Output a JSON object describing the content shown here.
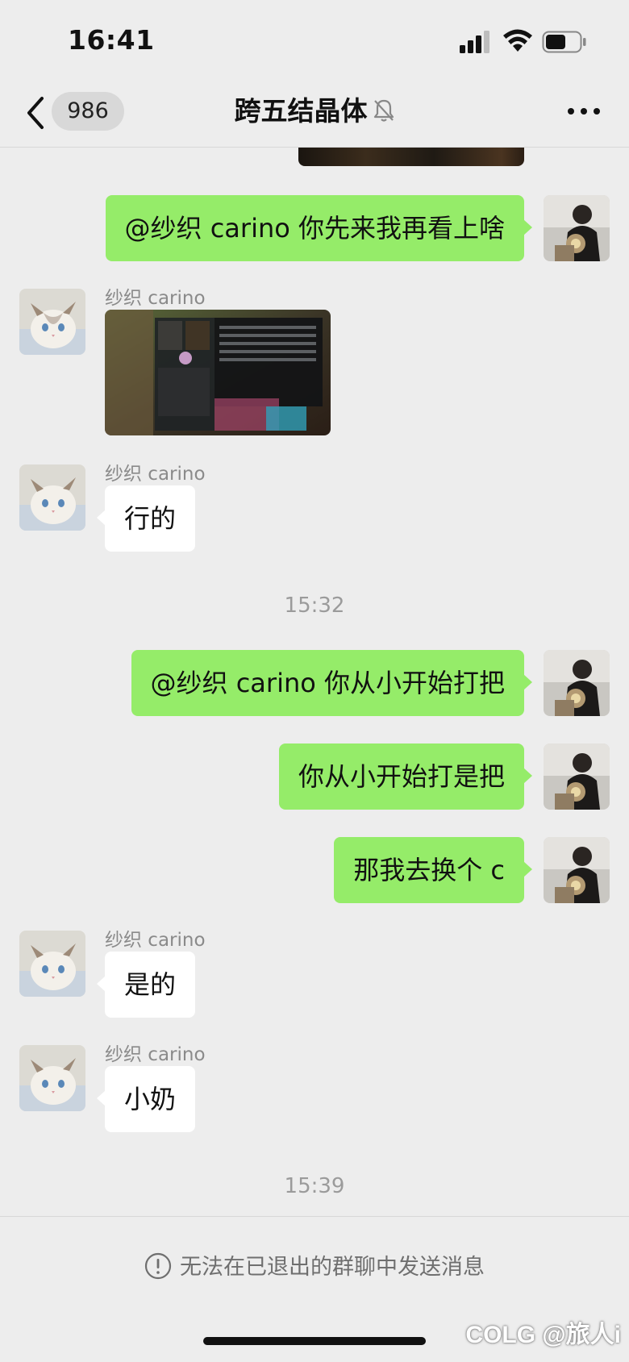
{
  "status_bar": {
    "time": "16:41",
    "signal_icon": "cellular-signal-icon",
    "wifi_icon": "wifi-icon",
    "battery_icon": "battery-icon",
    "battery_level": 0.6
  },
  "header": {
    "unread_count": "986",
    "title": "跨五结晶体",
    "muted": true,
    "back_icon": "back-chevron-icon",
    "more_icon": "more-dots-icon",
    "mute_icon": "muted-bell-icon"
  },
  "messages": [
    {
      "side": "self",
      "type": "text",
      "text": "@纱织 carino 你先来我再看上啥"
    },
    {
      "side": "other",
      "type": "image",
      "sender": "纱织 carino"
    },
    {
      "side": "other",
      "type": "text",
      "sender": "纱织 carino",
      "text": "行的"
    },
    {
      "type": "timestamp",
      "text": "15:32"
    },
    {
      "side": "self",
      "type": "text",
      "text": "@纱织 carino 你从小开始打把"
    },
    {
      "side": "self",
      "type": "text",
      "text": "你从小开始打是把"
    },
    {
      "side": "self",
      "type": "text",
      "text": "那我去换个 c"
    },
    {
      "side": "other",
      "type": "text",
      "sender": "纱织 carino",
      "text": "是的"
    },
    {
      "side": "other",
      "type": "text",
      "sender": "纱织 carino",
      "text": "小奶"
    },
    {
      "type": "timestamp",
      "text": "15:39"
    }
  ],
  "footer": {
    "notice": "无法在已退出的群聊中发送消息",
    "notice_icon": "warning-circle-icon"
  },
  "watermark": "COLG @旅人i",
  "colors": {
    "background": "#ededed",
    "self_bubble": "#95ec69",
    "other_bubble": "#ffffff",
    "meta_text": "#8a8a8a"
  }
}
